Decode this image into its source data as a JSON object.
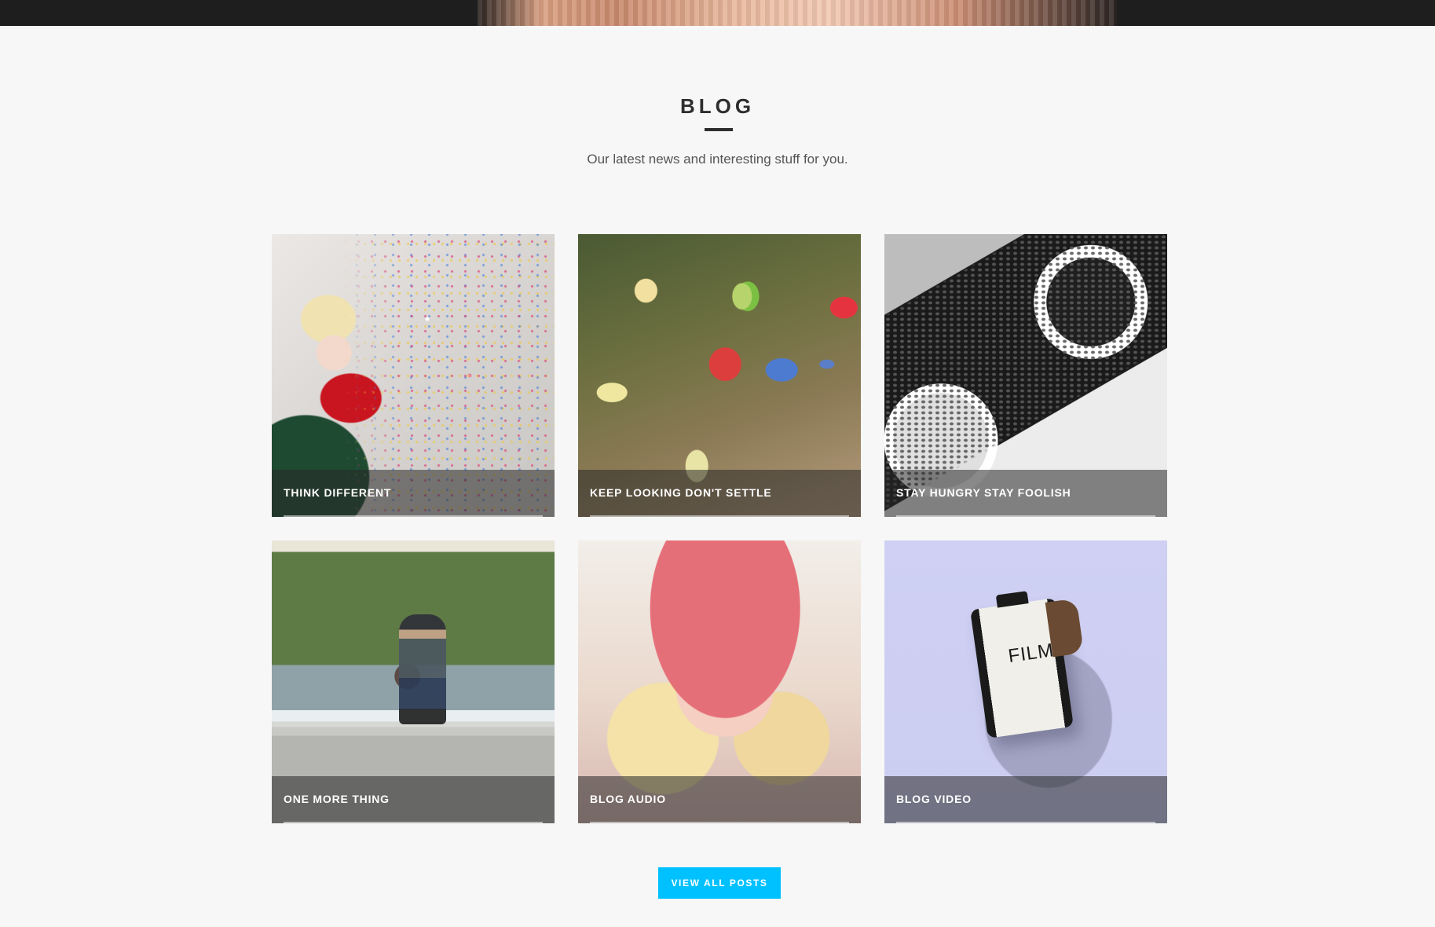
{
  "section": {
    "title": "BLOG",
    "subtitle": "Our latest news and interesting stuff for you."
  },
  "posts": [
    {
      "title": "THINK DIFFERENT"
    },
    {
      "title": "KEEP LOOKING DON'T SETTLE"
    },
    {
      "title": "STAY HUNGRY STAY FOOLISH"
    },
    {
      "title": "ONE MORE THING"
    },
    {
      "title": "BLOG AUDIO"
    },
    {
      "title": "BLOG VIDEO"
    }
  ],
  "film_label": "FILM",
  "view_all_label": "VIEW ALL POSTS",
  "colors": {
    "accent": "#00c1ff",
    "background": "#f7f7f7",
    "heading": "#2e2e2e"
  }
}
